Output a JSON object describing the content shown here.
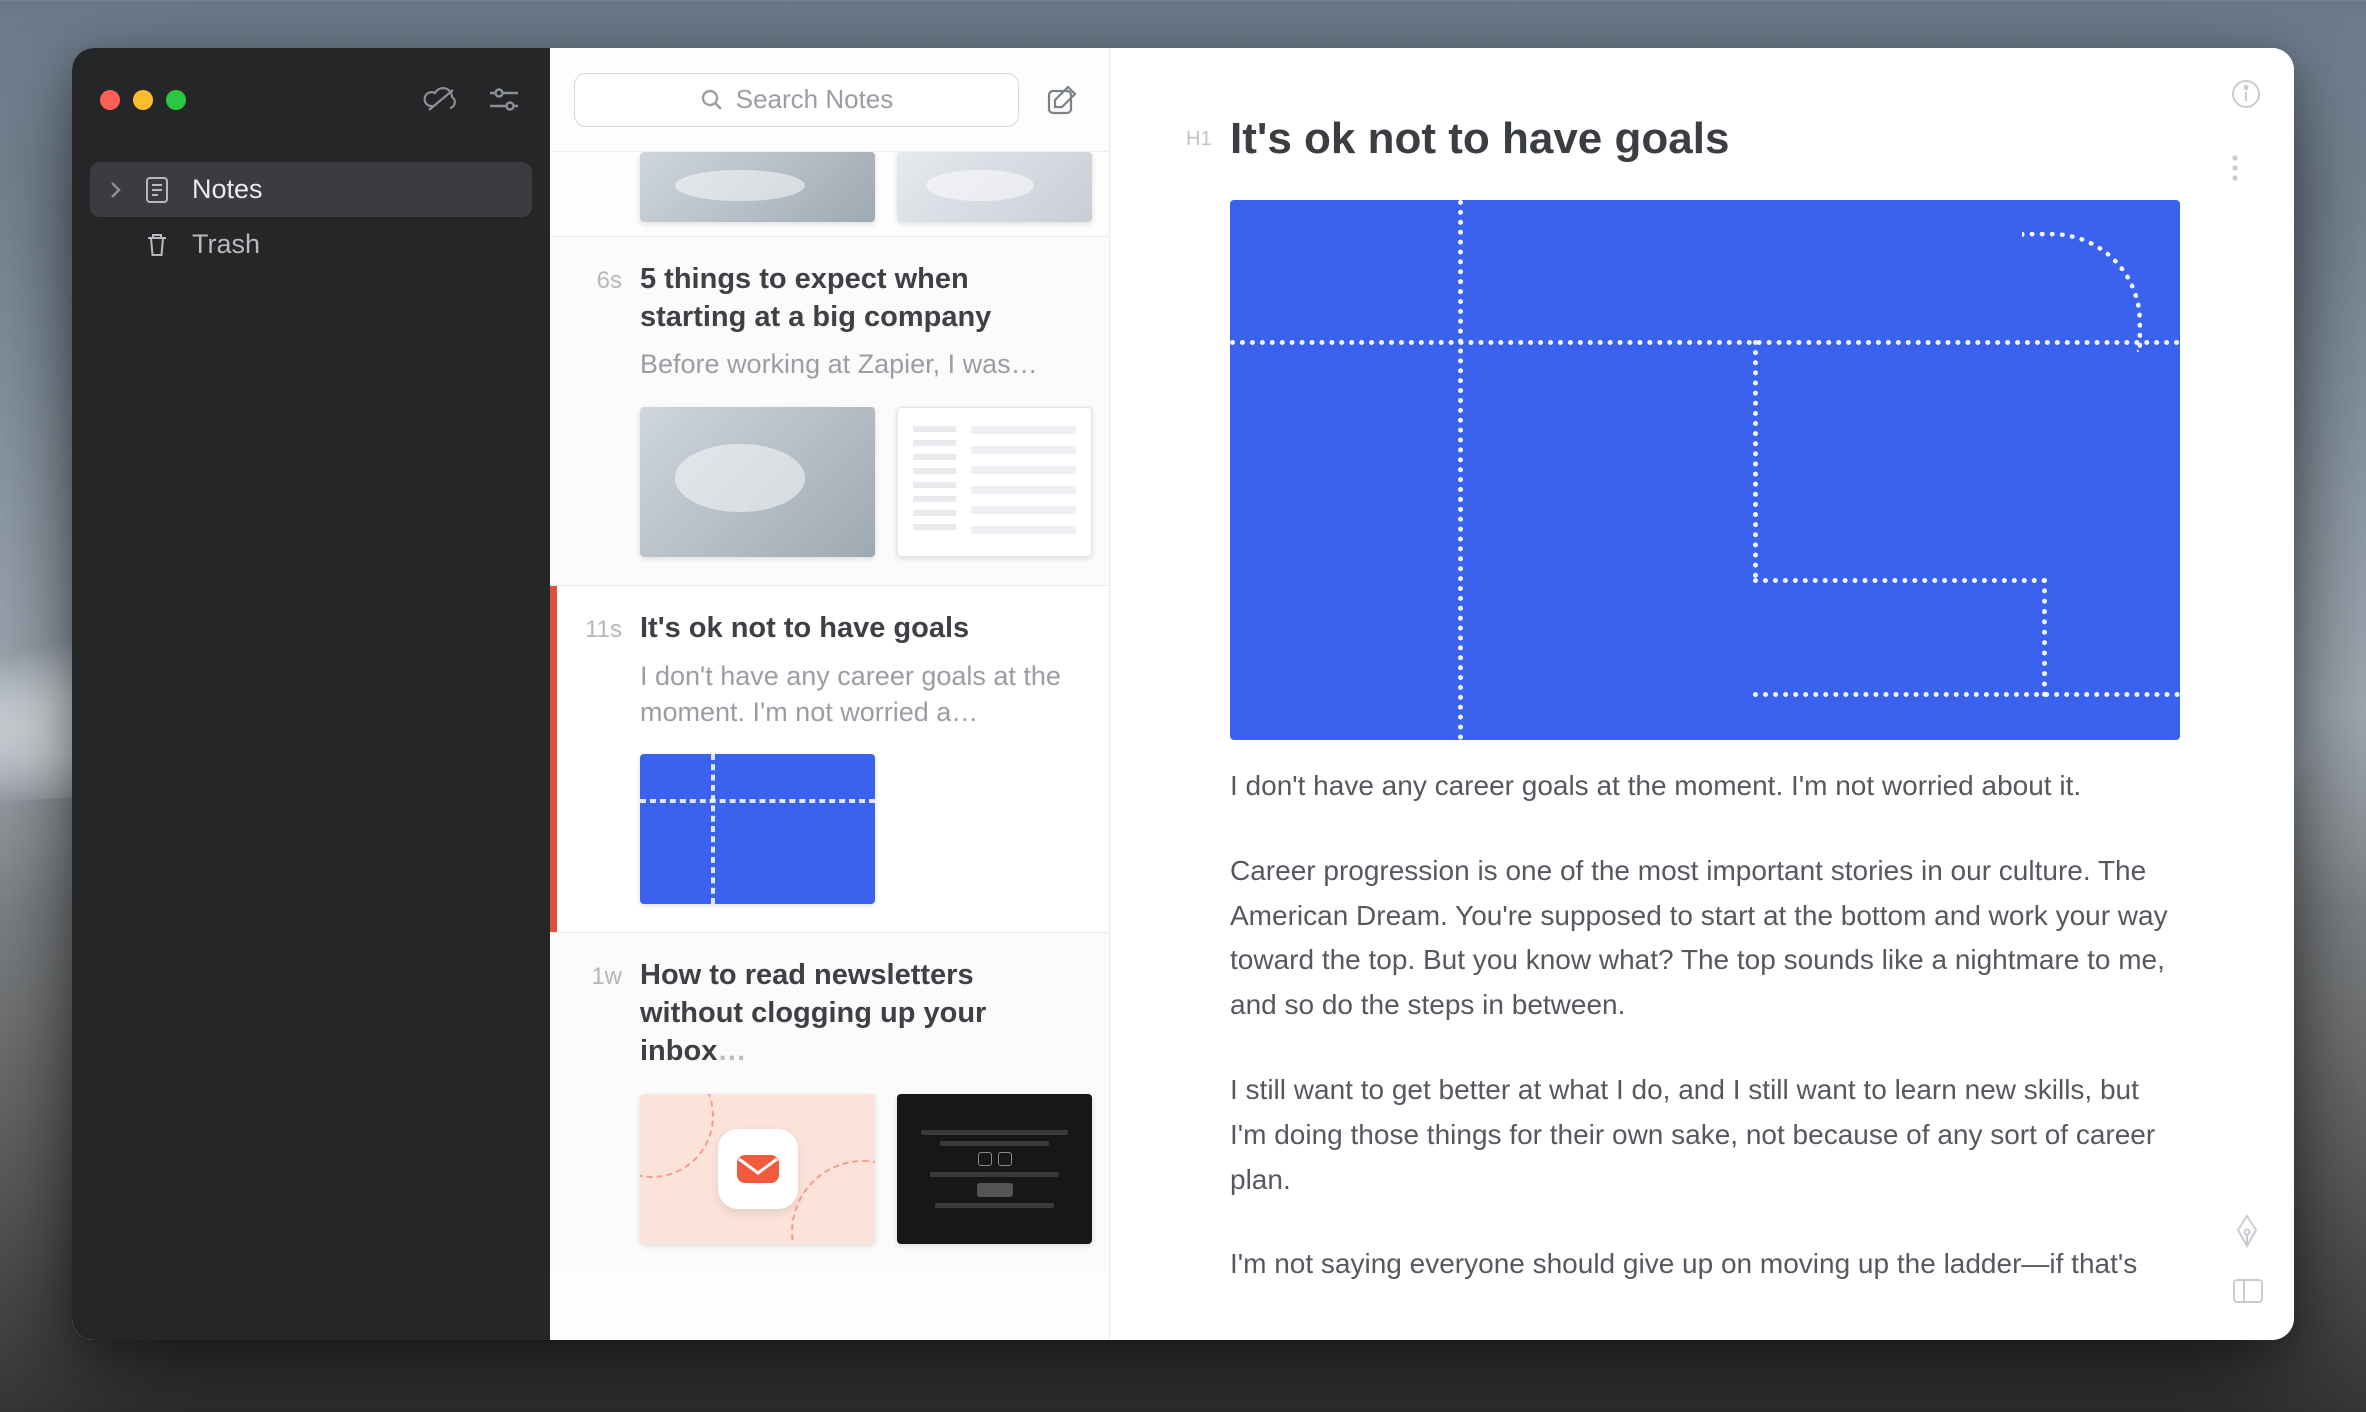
{
  "sidebar": {
    "items": [
      {
        "label": "Notes",
        "active": true
      },
      {
        "label": "Trash",
        "active": false
      }
    ]
  },
  "search": {
    "placeholder": "Search Notes"
  },
  "notes": [
    {
      "time": "6s",
      "title": "5 things to expect when starting at a big company",
      "preview": "Before working at Zapier, I was…",
      "selected": false
    },
    {
      "time": "11s",
      "title": "It's ok not to have goals",
      "preview": "I don't have any career goals at the moment. I'm not worried a…",
      "selected": true
    },
    {
      "time": "1w",
      "title": "How to read newsletters without clogging up your inbox",
      "title_suffix": "…",
      "preview": "",
      "selected": false
    }
  ],
  "editor": {
    "heading_tag": "H1",
    "title": "It's ok not to have goals",
    "paragraphs": [
      "I don't have any career goals at the moment. I'm not worried about it.",
      "Career progression is one of the most important stories in our culture. The American Dream. You're supposed to start at the bottom and work your way toward the top. But you know what? The top sounds like a nightmare to me, and so do the steps in between.",
      "I still want to get better at what I do, and I still want to learn new skills, but I'm doing those things for their own sake, not because of any sort of career plan.",
      "I'm not saying everyone should give up on moving up the ladder—if that's"
    ]
  },
  "colors": {
    "selection_accent": "#e0513d",
    "hero_blue": "#3b62ee"
  }
}
